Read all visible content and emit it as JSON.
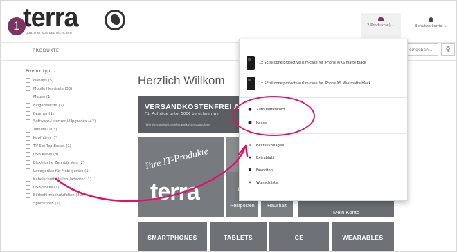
{
  "step": "1",
  "logo": {
    "word": "terra",
    "tagline": "QUALITÄT AUS DEUTSCHLAND"
  },
  "header": {
    "cart_label": "2 Produkt(e) ⌄",
    "account_label": "Benutzerkonto ⌄"
  },
  "nav": {
    "produkte": "PRODUKTE",
    "search_placeholder": "eingeben..."
  },
  "sidebar": {
    "title": "Produkttyp ⌄",
    "items": [
      "Handys (5)",
      "Mobile Headsets (30)",
      "Mause (1)",
      "Eingabestifte (2)",
      "Beamer (1)",
      "Software-Lizenzen/-Upgrades (42)",
      "Tablets (103)",
      "Kopfhörer (7)",
      "TV Set-Top-Boxen (1)",
      "USB Kabel (3)",
      "Elektrische Zahnbürsten (2)",
      "Ladegeräte für Mobilgeräte (1)",
      "Kabelschnittstellen-/adapter (1)",
      "USB-Sticks (1)",
      "Bildschirmschutzfolien (32)",
      "Sportuhren (1)"
    ]
  },
  "main": {
    "welcome": "Herzlich Willkom",
    "banner_title": "VERSANDKOSTENFREI A",
    "banner_sub": "Für Aufträge unter 500€ berechnen wir",
    "banner_note": "*Die Versandkosten/Versandkostenpauschale",
    "tile_slogan": "Ihre IT-Produkte",
    "tile_brand": "terra",
    "tile_restposten": "Restposten",
    "tile_haushalt": "Haushalt",
    "tile_konto": "Mein Konto",
    "categories": [
      "SMARTPHONES",
      "TABLETS",
      "CE",
      "WEARABLES"
    ]
  },
  "dropdown": {
    "products": [
      "1x SE silicone protective slim-case for iPhone X/XS matte black",
      "1x SE silicone protective slim-case for iPhone XS Max matte black"
    ],
    "actions": [
      "Zum Warenkorb",
      "Kasse"
    ],
    "links": [
      "Bestellvorlagen",
      "Extrablatt",
      "Favoriten",
      "Wunschliste"
    ]
  },
  "colors": {
    "accent": "#7b3560",
    "highlight": "#e2116b",
    "tile": "#6e7276"
  }
}
